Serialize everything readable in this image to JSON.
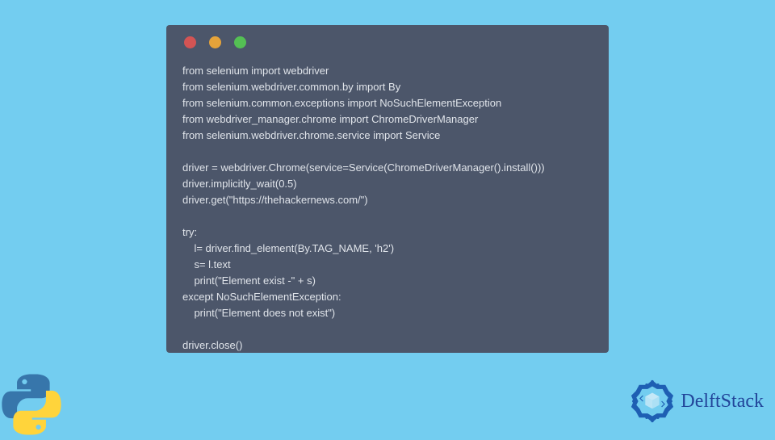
{
  "code": {
    "lines": [
      "from selenium import webdriver",
      "from selenium.webdriver.common.by import By",
      "from selenium.common.exceptions import NoSuchElementException",
      "from webdriver_manager.chrome import ChromeDriverManager",
      "from selenium.webdriver.chrome.service import Service",
      "",
      "driver = webdriver.Chrome(service=Service(ChromeDriverManager().install()))",
      "driver.implicitly_wait(0.5)",
      "driver.get(\"https://thehackernews.com/\")",
      "",
      "try:",
      "    l= driver.find_element(By.TAG_NAME, 'h2')",
      "    s= l.text",
      "    print(\"Element exist -\" + s)",
      "except NoSuchElementException:",
      "    print(\"Element does not exist\")",
      "",
      "driver.close()"
    ]
  },
  "brand": {
    "name": "DelftStack"
  }
}
